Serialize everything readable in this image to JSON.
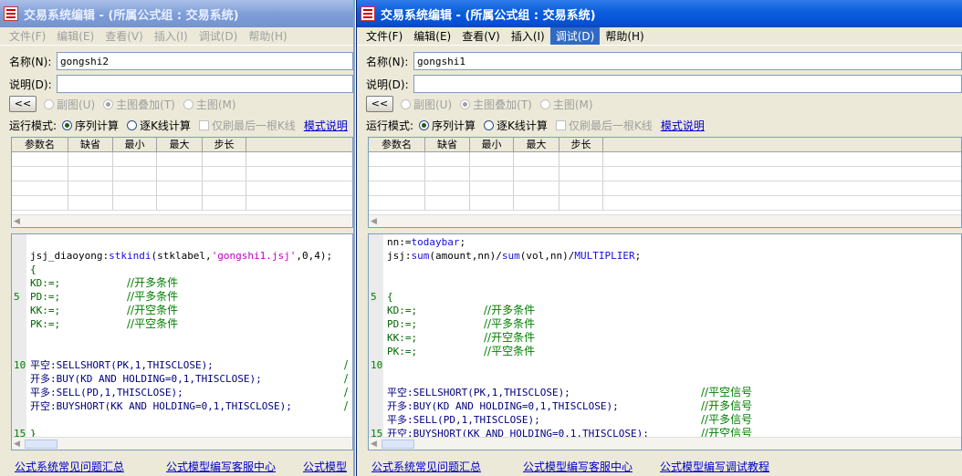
{
  "left_window": {
    "title": "交易系统编辑 - (所属公式组 : 交易系统)",
    "menu": [
      "文件(F)",
      "编辑(E)",
      "查看(V)",
      "插入(I)",
      "调试(D)",
      "帮助(H)"
    ],
    "name_label": "名称(N):",
    "name_value": "gongshi2",
    "desc_label": "说明(D):",
    "desc_value": "",
    "collapse_button": "<<",
    "chart_modes": [
      "副图(U)",
      "主图叠加(T)",
      "主图(M)"
    ],
    "run_mode_label": "运行模式:",
    "run_modes": [
      "序列计算",
      "逐K线计算"
    ],
    "last_bar_only": "仅刷最后一根K线",
    "mode_help_link": "模式说明",
    "param_columns": [
      "参数名",
      "缺省",
      "最小",
      "最大",
      "步长"
    ],
    "code_lines": {
      "l1": "jsj_diaoyong:",
      "l1_fn": "stkindi",
      "l1_args": "(stklabel,",
      "l1_str": "'gongshi1.jsj'",
      "l1_end": ",0,4);",
      "l2": "{",
      "kd": "KD:=;",
      "pd": "PD:=;",
      "kk": "KK:=;",
      "pk": "PK:=;",
      "c_kd": "//开多条件",
      "c_pd": "//平多条件",
      "c_kk": "//开空条件",
      "c_pk": "//平空条件",
      "s1": "平空:SELLSHORT(PK,1,THISCLOSE);",
      "s2": "开多:BUY(KD AND HOLDING=0,1,THISCLOSE);",
      "s3": "平多:SELL(PD,1,THISCLOSE);",
      "s4": "开空:BUYSHORT(KK AND HOLDING=0,1,THISCLOSE);",
      "cut": "/",
      "close": "}"
    },
    "line_numbers": [
      "5",
      "10",
      "15"
    ],
    "footer_links": [
      "公式系统常见问题汇总",
      "公式模型编写客服中心",
      "公式模型"
    ]
  },
  "right_window": {
    "title": "交易系统编辑 - (所属公式组 : 交易系统)",
    "menu": [
      "文件(F)",
      "编辑(E)",
      "查看(V)",
      "插入(I)",
      "调试(D)",
      "帮助(H)"
    ],
    "name_label": "名称(N):",
    "name_value": "gongshi1",
    "desc_label": "说明(D):",
    "desc_value": "",
    "collapse_button": "<<",
    "chart_modes": [
      "副图(U)",
      "主图叠加(T)",
      "主图(M)"
    ],
    "run_mode_label": "运行模式:",
    "run_modes": [
      "序列计算",
      "逐K线计算"
    ],
    "last_bar_only": "仅刷最后一根K线",
    "mode_help_link": "模式说明",
    "param_columns": [
      "参数名",
      "缺省",
      "最小",
      "最大",
      "步长"
    ],
    "code_lines": {
      "l1a": "nn:=",
      "l1b": "todaybar",
      "l1c": ";",
      "l2a": "jsj:",
      "l2b": "sum",
      "l2c": "(amount,nn)/",
      "l2d": "sum",
      "l2e": "(vol,nn)/",
      "l2f": "MULTIPLIER",
      "l2g": ";",
      "open": "{",
      "kd": "KD:=;",
      "pd": "PD:=;",
      "kk": "KK:=;",
      "pk": "PK:=;",
      "c_kd": "//开多条件",
      "c_pd": "//平多条件",
      "c_kk": "//开空条件",
      "c_pk": "//平空条件",
      "s1": "平空:SELLSHORT(PK,1,THISCLOSE);",
      "s2": "开多:BUY(KD AND HOLDING=0,1,THISCLOSE);",
      "s3": "平多:SELL(PD,1,THISCLOSE);",
      "s4": "开空:BUYSHORT(KK AND HOLDING=0,1,THISCLOSE);",
      "c_s1": "//平空信号",
      "c_s2": "//开多信号",
      "c_s3": "//平多信号",
      "c_s4": "//开空信号"
    },
    "line_numbers": [
      "5",
      "10",
      "15"
    ],
    "footer_links": [
      "公式系统常见问题汇总",
      "公式模型编写客服中心",
      "公式模型编写调试教程"
    ]
  }
}
